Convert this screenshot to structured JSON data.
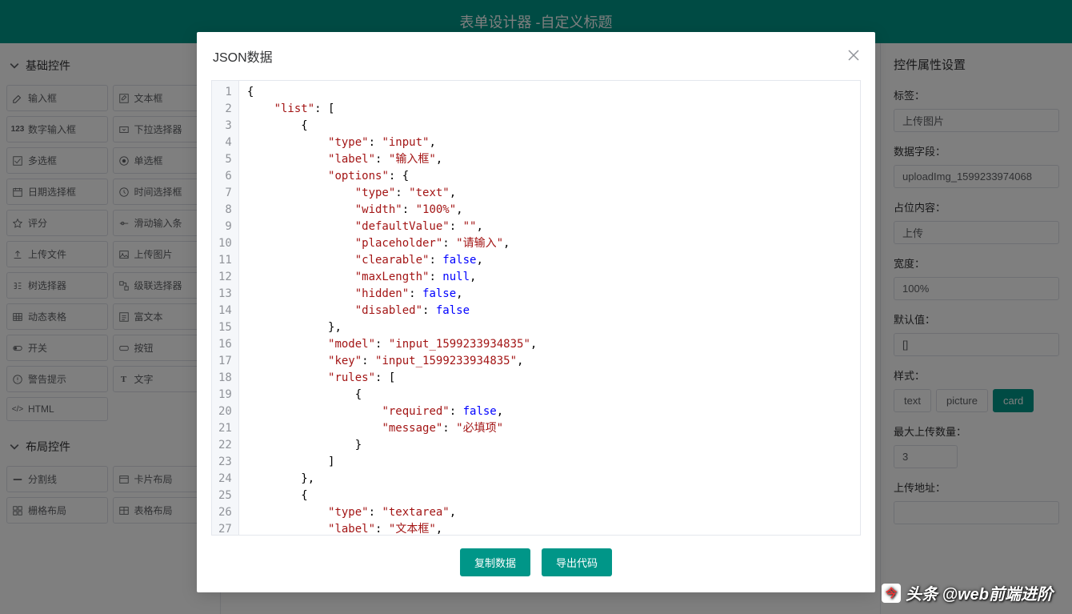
{
  "header": {
    "title": "表单设计器 -自定义标题"
  },
  "left": {
    "sections": {
      "basic": {
        "label": "基础控件"
      },
      "layout": {
        "label": "布局控件"
      }
    },
    "basic_items": [
      {
        "icon": "edit",
        "label": "输入框"
      },
      {
        "icon": "edit-box",
        "label": "文本框"
      },
      {
        "icon": "num",
        "label": "数字输入框"
      },
      {
        "icon": "dropdown",
        "label": "下拉选择器"
      },
      {
        "icon": "checkbox",
        "label": "多选框"
      },
      {
        "icon": "radio",
        "label": "单选框"
      },
      {
        "icon": "calendar",
        "label": "日期选择框"
      },
      {
        "icon": "clock",
        "label": "时间选择框"
      },
      {
        "icon": "star",
        "label": "评分"
      },
      {
        "icon": "slider",
        "label": "滑动输入条"
      },
      {
        "icon": "upload",
        "label": "上传文件"
      },
      {
        "icon": "image",
        "label": "上传图片"
      },
      {
        "icon": "tree",
        "label": "树选择器"
      },
      {
        "icon": "cascade",
        "label": "级联选择器"
      },
      {
        "icon": "table",
        "label": "动态表格"
      },
      {
        "icon": "rich",
        "label": "富文本"
      },
      {
        "icon": "switch",
        "label": "开关"
      },
      {
        "icon": "button",
        "label": "按钮"
      },
      {
        "icon": "alert",
        "label": "警告提示"
      },
      {
        "icon": "text",
        "label": "文字"
      },
      {
        "icon": "code",
        "label": "HTML"
      }
    ],
    "layout_items": [
      {
        "icon": "divider",
        "label": "分割线"
      },
      {
        "icon": "card",
        "label": "卡片布局"
      },
      {
        "icon": "grid",
        "label": "栅格布局"
      },
      {
        "icon": "table2",
        "label": "表格布局"
      }
    ]
  },
  "right": {
    "title": "控件属性设置",
    "label_lbl": "标签：",
    "label_val": "上传图片",
    "field_lbl": "数据字段：",
    "field_val": "uploadImg_1599233974068",
    "placeholder_lbl": "占位内容：",
    "placeholder_val": "上传",
    "width_lbl": "宽度：",
    "width_val": "100%",
    "default_lbl": "默认值：",
    "default_val": "[]",
    "style_lbl": "样式：",
    "style_opts": {
      "a": "text",
      "b": "picture",
      "c": "card"
    },
    "max_lbl": "最大上传数量：",
    "max_val": "3",
    "url_lbl": "上传地址：",
    "url_val": ""
  },
  "dialog": {
    "title": "JSON数据",
    "copy_btn": "复制数据",
    "export_btn": "导出代码",
    "code_lines": [
      [
        [
          "punc",
          "{"
        ]
      ],
      [
        [
          "plain",
          "    "
        ],
        [
          "key",
          "\"list\""
        ],
        [
          "punc",
          ": ["
        ]
      ],
      [
        [
          "plain",
          "        "
        ],
        [
          "punc",
          "{"
        ]
      ],
      [
        [
          "plain",
          "            "
        ],
        [
          "key",
          "\"type\""
        ],
        [
          "punc",
          ": "
        ],
        [
          "str",
          "\"input\""
        ],
        [
          "punc",
          ","
        ]
      ],
      [
        [
          "plain",
          "            "
        ],
        [
          "key",
          "\"label\""
        ],
        [
          "punc",
          ": "
        ],
        [
          "str",
          "\"输入框\""
        ],
        [
          "punc",
          ","
        ]
      ],
      [
        [
          "plain",
          "            "
        ],
        [
          "key",
          "\"options\""
        ],
        [
          "punc",
          ": {"
        ]
      ],
      [
        [
          "plain",
          "                "
        ],
        [
          "key",
          "\"type\""
        ],
        [
          "punc",
          ": "
        ],
        [
          "str",
          "\"text\""
        ],
        [
          "punc",
          ","
        ]
      ],
      [
        [
          "plain",
          "                "
        ],
        [
          "key",
          "\"width\""
        ],
        [
          "punc",
          ": "
        ],
        [
          "str",
          "\"100%\""
        ],
        [
          "punc",
          ","
        ]
      ],
      [
        [
          "plain",
          "                "
        ],
        [
          "key",
          "\"defaultValue\""
        ],
        [
          "punc",
          ": "
        ],
        [
          "str",
          "\"\""
        ],
        [
          "punc",
          ","
        ]
      ],
      [
        [
          "plain",
          "                "
        ],
        [
          "key",
          "\"placeholder\""
        ],
        [
          "punc",
          ": "
        ],
        [
          "str",
          "\"请输入\""
        ],
        [
          "punc",
          ","
        ]
      ],
      [
        [
          "plain",
          "                "
        ],
        [
          "key",
          "\"clearable\""
        ],
        [
          "punc",
          ": "
        ],
        [
          "kw",
          "false"
        ],
        [
          "punc",
          ","
        ]
      ],
      [
        [
          "plain",
          "                "
        ],
        [
          "key",
          "\"maxLength\""
        ],
        [
          "punc",
          ": "
        ],
        [
          "kw",
          "null"
        ],
        [
          "punc",
          ","
        ]
      ],
      [
        [
          "plain",
          "                "
        ],
        [
          "key",
          "\"hidden\""
        ],
        [
          "punc",
          ": "
        ],
        [
          "kw",
          "false"
        ],
        [
          "punc",
          ","
        ]
      ],
      [
        [
          "plain",
          "                "
        ],
        [
          "key",
          "\"disabled\""
        ],
        [
          "punc",
          ": "
        ],
        [
          "kw",
          "false"
        ]
      ],
      [
        [
          "plain",
          "            "
        ],
        [
          "punc",
          "},"
        ]
      ],
      [
        [
          "plain",
          "            "
        ],
        [
          "key",
          "\"model\""
        ],
        [
          "punc",
          ": "
        ],
        [
          "str",
          "\"input_1599233934835\""
        ],
        [
          "punc",
          ","
        ]
      ],
      [
        [
          "plain",
          "            "
        ],
        [
          "key",
          "\"key\""
        ],
        [
          "punc",
          ": "
        ],
        [
          "str",
          "\"input_1599233934835\""
        ],
        [
          "punc",
          ","
        ]
      ],
      [
        [
          "plain",
          "            "
        ],
        [
          "key",
          "\"rules\""
        ],
        [
          "punc",
          ": ["
        ]
      ],
      [
        [
          "plain",
          "                "
        ],
        [
          "punc",
          "{"
        ]
      ],
      [
        [
          "plain",
          "                    "
        ],
        [
          "key",
          "\"required\""
        ],
        [
          "punc",
          ": "
        ],
        [
          "kw",
          "false"
        ],
        [
          "punc",
          ","
        ]
      ],
      [
        [
          "plain",
          "                    "
        ],
        [
          "key",
          "\"message\""
        ],
        [
          "punc",
          ": "
        ],
        [
          "str",
          "\"必填项\""
        ]
      ],
      [
        [
          "plain",
          "                "
        ],
        [
          "punc",
          "}"
        ]
      ],
      [
        [
          "plain",
          "            "
        ],
        [
          "punc",
          "]"
        ]
      ],
      [
        [
          "plain",
          "        "
        ],
        [
          "punc",
          "},"
        ]
      ],
      [
        [
          "plain",
          "        "
        ],
        [
          "punc",
          "{"
        ]
      ],
      [
        [
          "plain",
          "            "
        ],
        [
          "key",
          "\"type\""
        ],
        [
          "punc",
          ": "
        ],
        [
          "str",
          "\"textarea\""
        ],
        [
          "punc",
          ","
        ]
      ],
      [
        [
          "plain",
          "            "
        ],
        [
          "key",
          "\"label\""
        ],
        [
          "punc",
          ": "
        ],
        [
          "str",
          "\"文本框\""
        ],
        [
          "punc",
          ","
        ]
      ]
    ]
  },
  "watermark": "头条 @web前端进阶"
}
